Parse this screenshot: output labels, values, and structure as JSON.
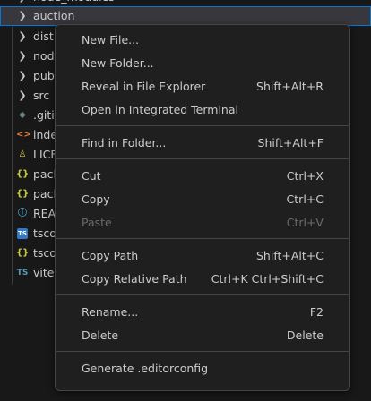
{
  "explorer": {
    "rows": [
      {
        "label": "node_modules",
        "kind": "folder",
        "chevron": "chevron-right-icon"
      },
      {
        "label": "auction",
        "kind": "folder",
        "chevron": "chevron-right-icon"
      },
      {
        "label": "dist",
        "kind": "folder",
        "chevron": "chevron-right-icon"
      },
      {
        "label": "nod",
        "kind": "folder",
        "chevron": "chevron-right-icon"
      },
      {
        "label": "pub",
        "kind": "folder",
        "chevron": "chevron-right-icon"
      },
      {
        "label": "src",
        "kind": "folder",
        "chevron": "chevron-right-icon"
      },
      {
        "label": ".gitig",
        "kind": "file",
        "icon": "git-diamond-icon",
        "glyph": "◆",
        "color": "#6d8086"
      },
      {
        "label": "inde",
        "kind": "file",
        "icon": "html-brackets-icon",
        "glyph": "<>",
        "color": "#e37933"
      },
      {
        "label": "LICE",
        "kind": "file",
        "icon": "license-ribbon-icon",
        "glyph": "♙",
        "color": "#cbcb41"
      },
      {
        "label": "pacl",
        "kind": "file",
        "icon": "json-braces-icon",
        "glyph": "{}",
        "color": "#cbcb41"
      },
      {
        "label": "pacl",
        "kind": "file",
        "icon": "json-braces-icon",
        "glyph": "{}",
        "color": "#cbcb41"
      },
      {
        "label": "REA",
        "kind": "file",
        "icon": "info-circle-icon",
        "glyph": "ⓘ",
        "color": "#519aba"
      },
      {
        "label": "tsco",
        "kind": "file",
        "icon": "tsconfig-icon",
        "glyph": "TS",
        "color": "#519aba"
      },
      {
        "label": "tsco",
        "kind": "file",
        "icon": "json-braces-icon",
        "glyph": "{}",
        "color": "#cbcb41"
      },
      {
        "label": "vite.",
        "kind": "file",
        "icon": "typescript-icon",
        "glyph": "TS",
        "color": "#519aba"
      }
    ]
  },
  "menu": {
    "items": [
      {
        "label": "New File...",
        "shortcut": "",
        "enabled": true
      },
      {
        "label": "New Folder...",
        "shortcut": "",
        "enabled": true
      },
      {
        "label": "Reveal in File Explorer",
        "shortcut": "Shift+Alt+R",
        "enabled": true
      },
      {
        "label": "Open in Integrated Terminal",
        "shortcut": "",
        "enabled": true
      },
      {
        "label": "Find in Folder...",
        "shortcut": "Shift+Alt+F",
        "enabled": true
      },
      {
        "label": "Cut",
        "shortcut": "Ctrl+X",
        "enabled": true
      },
      {
        "label": "Copy",
        "shortcut": "Ctrl+C",
        "enabled": true
      },
      {
        "label": "Paste",
        "shortcut": "Ctrl+V",
        "enabled": false
      },
      {
        "label": "Copy Path",
        "shortcut": "Shift+Alt+C",
        "enabled": true
      },
      {
        "label": "Copy Relative Path",
        "shortcut": "Ctrl+K Ctrl+Shift+C",
        "enabled": true
      },
      {
        "label": "Rename...",
        "shortcut": "F2",
        "enabled": true
      },
      {
        "label": "Delete",
        "shortcut": "Delete",
        "enabled": true
      },
      {
        "label": "Generate .editorconfig",
        "shortcut": "",
        "enabled": true
      }
    ]
  },
  "colors": {
    "background": "#181818",
    "menu_background": "#1f1f1f",
    "menu_border": "#454545",
    "text": "#cccccc",
    "disabled_text": "#6b6b6b",
    "focus_border": "#0078d4",
    "selection": "#37373d"
  }
}
